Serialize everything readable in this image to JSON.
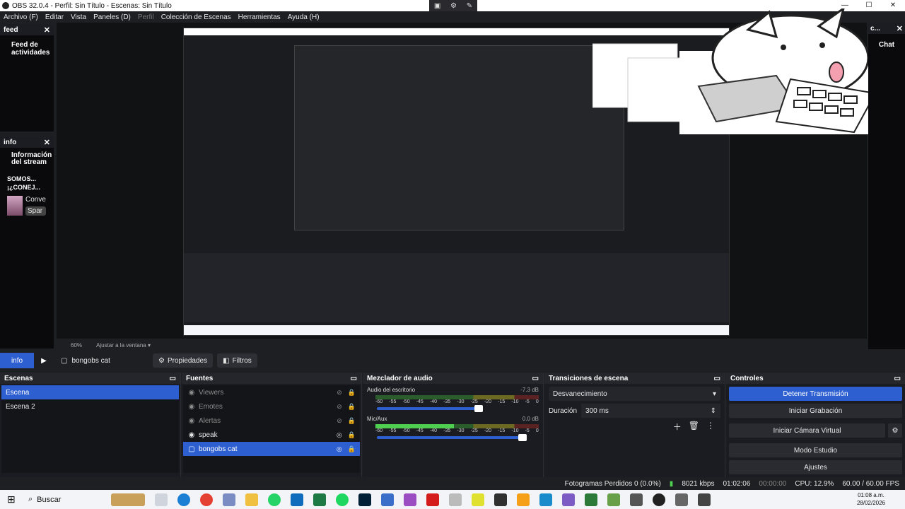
{
  "window": {
    "title": "OBS 32.0.4 - Perfil: Sin Título - Escenas: Sin Título",
    "controls": [
      "—",
      "☐",
      "✕"
    ]
  },
  "menu": {
    "items": [
      "Archivo (F)",
      "Editar",
      "Vista",
      "Paneles (D)",
      "Perfil",
      "Colección de Escenas",
      "Herramientas",
      "Ayuda (H)"
    ]
  },
  "docks": {
    "feed": {
      "header": "feed",
      "title_line1": "Feed de",
      "title_line2": "actividades"
    },
    "info": {
      "header": "info",
      "title_line1": "Información",
      "title_line2": "del stream",
      "text_line1": "SOMOS...",
      "text_line2": "¡¿CONEJ...",
      "user_label": "Conve",
      "tag": "Spar"
    },
    "chat": {
      "header": "c...",
      "title": "Chat"
    }
  },
  "zoom": {
    "level": "60%",
    "fit_label": "Ajustar a la ventana"
  },
  "source_bar": {
    "info_tab": "info",
    "selected_source": "bongobs cat",
    "properties": "Propiedades",
    "filters": "Filtros"
  },
  "scenes": {
    "title": "Escenas",
    "items": [
      {
        "name": "Escena",
        "selected": true
      },
      {
        "name": "Escena 2",
        "selected": false
      }
    ]
  },
  "sources": {
    "title": "Fuentes",
    "items": [
      {
        "name": "Viewers",
        "dim": true
      },
      {
        "name": "Emotes",
        "dim": true
      },
      {
        "name": "Alertas",
        "dim": true
      },
      {
        "name": "speak",
        "dim": false
      },
      {
        "name": "bongobs cat",
        "selected": true
      }
    ]
  },
  "mixer": {
    "title": "Mezclador de audio",
    "channels": [
      {
        "name": "Audio del escritorio",
        "db": "-7.3 dB"
      },
      {
        "name": "Mic/Aux",
        "db": "0.0 dB"
      }
    ],
    "scale": [
      "-60",
      "-55",
      "-50",
      "-45",
      "-40",
      "-35",
      "-30",
      "-25",
      "-20",
      "-15",
      "-10",
      "-5",
      "0"
    ]
  },
  "transitions": {
    "title": "Transiciones de escena",
    "selected": "Desvanecimiento",
    "duration_label": "Duración",
    "duration_value": "300 ms"
  },
  "controls": {
    "title": "Controles",
    "buttons": [
      "Detener Transmisión",
      "Iniciar Grabación",
      "Iniciar Cámara Virtual",
      "Modo Estudio",
      "Ajustes"
    ]
  },
  "status": {
    "dropped": "Fotogramas Perdidos 0 (0.0%)",
    "bitrate": "8021 kbps",
    "stream_time": "01:02:06",
    "rec_time": "00:00:00",
    "cpu": "CPU: 12.9%",
    "fps": "60.00 / 60.00 FPS"
  },
  "taskbar": {
    "search_placeholder": "Buscar",
    "time": "01:08 a.m.",
    "date": "28/02/2026"
  },
  "colors": {
    "accent": "#2e5fd0",
    "background": "#1e1f23",
    "panel": "#1b1c21"
  }
}
